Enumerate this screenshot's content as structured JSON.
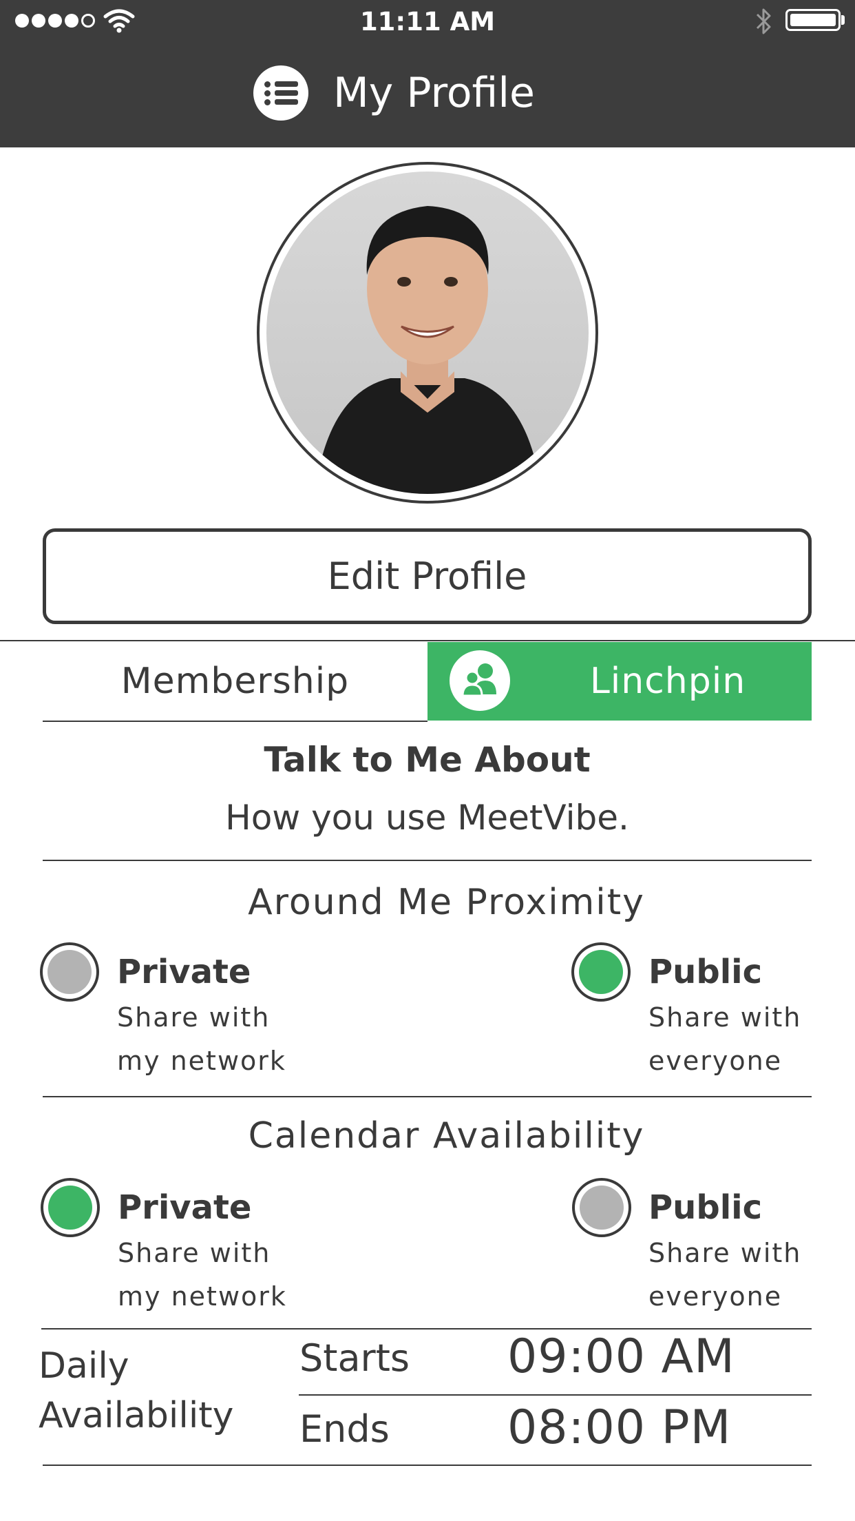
{
  "status_bar": {
    "time": "11:11 AM",
    "signal_dots_filled": 4,
    "signal_dots_total": 5
  },
  "nav": {
    "title": "My Profile",
    "menu_icon": "menu-list-icon"
  },
  "profile": {
    "edit_button_label": "Edit Profile"
  },
  "tabs": {
    "membership_label": "Membership",
    "linchpin_label": "Linchpin",
    "linchpin_icon": "users-icon"
  },
  "talk_to_me": {
    "title": "Talk to Me About",
    "value": "How you use MeetVibe."
  },
  "proximity": {
    "title": "Around Me Proximity",
    "private": {
      "label": "Private",
      "desc": "Share with my network",
      "selected": false
    },
    "public": {
      "label": "Public",
      "desc": "Share with everyone",
      "selected": true
    }
  },
  "calendar": {
    "title": "Calendar Availability",
    "private": {
      "label": "Private",
      "desc": "Share with my network",
      "selected": true
    },
    "public": {
      "label": "Public",
      "desc": "Share with everyone",
      "selected": false
    }
  },
  "daily": {
    "label": "Daily Availability",
    "starts_label": "Starts",
    "starts_value": "09:00 AM",
    "ends_label": "Ends",
    "ends_value": "08:00 PM"
  },
  "colors": {
    "accent": "#3db565",
    "header_bg": "#3d3d3d",
    "radio_off": "#b3b3b3",
    "text": "#3a3a3a"
  }
}
